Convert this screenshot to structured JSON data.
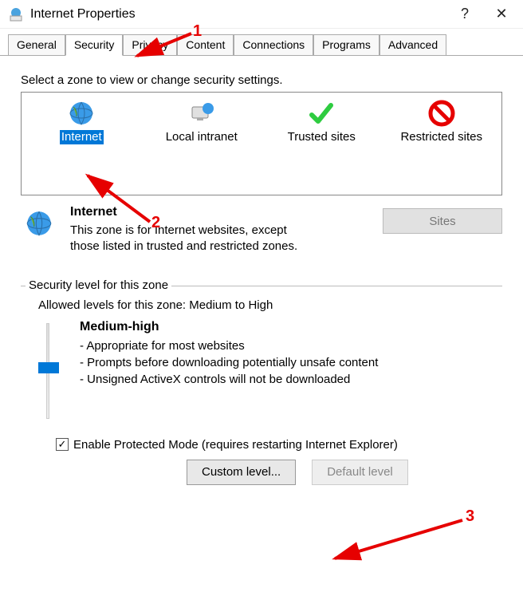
{
  "window": {
    "title": "Internet Properties",
    "help": "?",
    "close": "✕"
  },
  "tabs": {
    "general": "General",
    "security": "Security",
    "privacy": "Privacy",
    "content": "Content",
    "connections": "Connections",
    "programs": "Programs",
    "advanced": "Advanced"
  },
  "zones": {
    "instruction": "Select a zone to view or change security settings.",
    "items": [
      {
        "label": "Internet",
        "icon": "globe-icon"
      },
      {
        "label": "Local intranet",
        "icon": "monitor-globe-icon"
      },
      {
        "label": "Trusted sites",
        "icon": "check-icon"
      },
      {
        "label": "Restricted sites",
        "icon": "block-icon"
      }
    ]
  },
  "selectedZone": {
    "name": "Internet",
    "description": "This zone is for Internet websites, except those listed in trusted and restricted zones.",
    "sitesLabel": "Sites"
  },
  "security": {
    "groupLabel": "Security level for this zone",
    "allowedLevels": "Allowed levels for this zone: Medium to High",
    "levelName": "Medium-high",
    "b1": "- Appropriate for most websites",
    "b2": "- Prompts before downloading potentially unsafe content",
    "b3": "- Unsigned ActiveX controls will not be downloaded",
    "protectedMode": "Enable Protected Mode (requires restarting Internet Explorer)",
    "customLevel": "Custom level...",
    "defaultLevel": "Default level"
  },
  "annotations": {
    "n1": "1",
    "n2": "2",
    "n3": "3"
  }
}
